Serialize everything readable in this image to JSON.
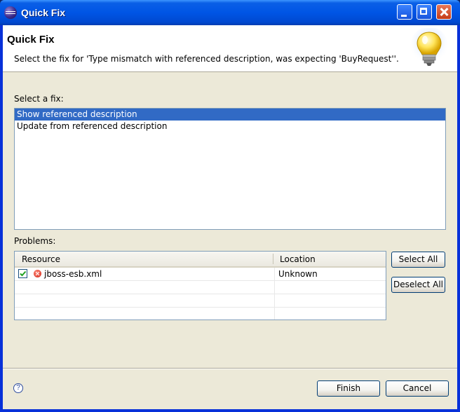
{
  "window": {
    "title": "Quick Fix",
    "icon": "eclipse-icon"
  },
  "header": {
    "title": "Quick Fix",
    "message": "Select the fix for 'Type mismatch with referenced description, was expecting 'BuyRequest''.",
    "icon": "lightbulb-icon"
  },
  "fixes": {
    "label": "Select a fix:",
    "items": [
      {
        "label": "Show referenced description",
        "selected": true
      },
      {
        "label": "Update from referenced description",
        "selected": false
      }
    ]
  },
  "problems": {
    "label": "Problems:",
    "columns": [
      "Resource",
      "Location"
    ],
    "rows": [
      {
        "checked": true,
        "status": "error",
        "resource": "jboss-esb.xml",
        "location": "Unknown"
      }
    ]
  },
  "buttons": {
    "select_all": "Select All",
    "deselect_all": "Deselect All",
    "finish": "Finish",
    "cancel": "Cancel",
    "help": "?"
  },
  "colors": {
    "titlebar": "#0055e5",
    "selection": "#316ac5",
    "dialog_bg": "#ece9d8"
  }
}
